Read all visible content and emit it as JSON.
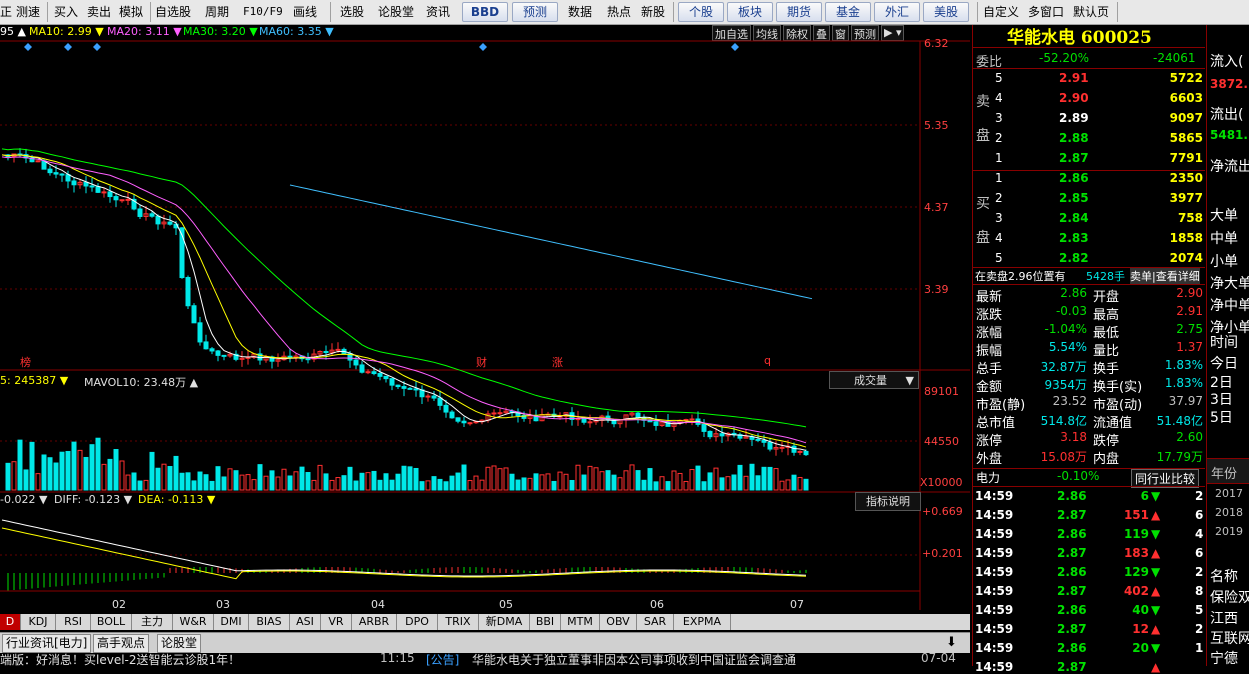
{
  "toolbar": {
    "left_items": [
      "正",
      "测速",
      "买入",
      "卖出",
      "模拟",
      "自选股",
      "周期",
      "F10/F9",
      "画线",
      "选股",
      "论股堂",
      "资讯"
    ],
    "bbd": "BBD",
    "forecast": "预测",
    "mid_items": [
      "数据",
      "热点",
      "新股"
    ],
    "market_buttons": [
      "个股",
      "板块",
      "期货",
      "基金",
      "外汇",
      "美股"
    ],
    "right_items": [
      "自定义",
      "多窗口",
      "默认页"
    ]
  },
  "chart": {
    "ma_labels": [
      {
        "text": "95 ▲",
        "color": "#ffffff"
      },
      {
        "text": "MA10: 2.99 ▼",
        "color": "#ffff00"
      },
      {
        "text": "MA20: 3.11 ▼",
        "color": "#ff60ff"
      },
      {
        "text": "MA30: 3.20 ▼",
        "color": "#00ff00"
      },
      {
        "text": "MA60: 3.35 ▼",
        "color": "#40c0ff"
      }
    ],
    "controls": [
      "加自选",
      "均线",
      "除权",
      "叠",
      "窗",
      "预测"
    ],
    "price_ticks": [
      "6.32",
      "5.35",
      "4.37",
      "3.39"
    ],
    "markers": [
      "榜",
      "财",
      "涨",
      "q"
    ],
    "vol_label_a": "5: 245387 ▼",
    "vol_label_b": "MAVOL10: 23.48万 ▲",
    "vol_dropdown": "成交量",
    "vol_ticks": [
      "89101",
      "44550",
      "X10000"
    ],
    "macd_label_a": "-0.022 ▼",
    "macd_label_b": "DIFF: -0.123 ▼",
    "macd_label_c": "DEA: -0.113 ▼",
    "macd_button": "指标说明",
    "macd_ticks": [
      "+0.669",
      "+0.201"
    ],
    "months": [
      "02",
      "03",
      "04",
      "05",
      "06",
      "07"
    ]
  },
  "index_tabs": [
    "D",
    "KDJ",
    "RSI",
    "BOLL",
    "主力",
    "W&R",
    "DMI",
    "BIAS",
    "ASI",
    "VR",
    "ARBR",
    "DPO",
    "TRIX",
    "新DMA",
    "BBI",
    "MTM",
    "OBV",
    "SAR",
    "EXPMA"
  ],
  "info_tabs": [
    "行业资讯[电力]",
    "高手观点",
    "论股堂"
  ],
  "news": {
    "left": "端版：好消息！买level-2送智能云诊股1年！",
    "time": "11:15",
    "tag": "[公告]",
    "headline": "华能水电关于独立董事非因本公司事项收到中国证监会调查通",
    "date": "07-04"
  },
  "quote": {
    "title": "华能水电 600025",
    "weibi_label": "委比",
    "weibi_pct": "-52.20%",
    "weibi_diff": "-24061",
    "sell_label": [
      "卖",
      "盘"
    ],
    "buy_label": [
      "买",
      "盘"
    ],
    "sells": [
      {
        "lvl": "5",
        "price": "2.91",
        "vol": "5722",
        "c": "#ff3030"
      },
      {
        "lvl": "4",
        "price": "2.90",
        "vol": "6603",
        "c": "#ff3030"
      },
      {
        "lvl": "3",
        "price": "2.89",
        "vol": "9097",
        "c": "#ffffff"
      },
      {
        "lvl": "2",
        "price": "2.88",
        "vol": "5865",
        "c": "#00e000"
      },
      {
        "lvl": "1",
        "price": "2.87",
        "vol": "7791",
        "c": "#00e000"
      }
    ],
    "buys": [
      {
        "lvl": "1",
        "price": "2.86",
        "vol": "2350",
        "c": "#00e000"
      },
      {
        "lvl": "2",
        "price": "2.85",
        "vol": "3977",
        "c": "#00e000"
      },
      {
        "lvl": "3",
        "price": "2.84",
        "vol": "758",
        "c": "#00e000"
      },
      {
        "lvl": "4",
        "price": "2.83",
        "vol": "1858",
        "c": "#00e000"
      },
      {
        "lvl": "5",
        "price": "2.82",
        "vol": "2074",
        "c": "#00e000"
      }
    ],
    "queue_a": "在卖盘2.96位置有",
    "queue_b": "5428手",
    "queue_c": "卖单|查看详细",
    "stats": [
      {
        "l": "最新",
        "v": "2.86",
        "vc": "#00e000",
        "l2": "开盘",
        "v2": "2.90",
        "v2c": "#ff3030"
      },
      {
        "l": "涨跌",
        "v": "-0.03",
        "vc": "#00e000",
        "l2": "最高",
        "v2": "2.91",
        "v2c": "#ff3030"
      },
      {
        "l": "涨幅",
        "v": "-1.04%",
        "vc": "#00e000",
        "l2": "最低",
        "v2": "2.75",
        "v2c": "#00e000"
      },
      {
        "l": "振幅",
        "v": "5.54%",
        "vc": "#00e8e8",
        "l2": "量比",
        "v2": "1.37",
        "v2c": "#ff3030"
      },
      {
        "l": "总手",
        "v": "32.87万",
        "vc": "#00e8e8",
        "l2": "换手",
        "v2": "1.83%",
        "v2c": "#00e8e8"
      },
      {
        "l": "金额",
        "v": "9354万",
        "vc": "#00e8e8",
        "l2": "换手(实)",
        "v2": "1.83%",
        "v2c": "#00e8e8"
      },
      {
        "l": "市盈(静)",
        "v": "23.52",
        "vc": "#c0c0c0",
        "l2": "市盈(动)",
        "v2": "37.97",
        "v2c": "#c0c0c0"
      },
      {
        "l": "总市值",
        "v": "514.8亿",
        "vc": "#00e8e8",
        "l2": "流通值",
        "v2": "51.48亿",
        "v2c": "#00e8e8"
      },
      {
        "l": "涨停",
        "v": "3.18",
        "vc": "#ff3030",
        "l2": "跌停",
        "v2": "2.60",
        "v2c": "#00e000"
      },
      {
        "l": "外盘",
        "v": "15.08万",
        "vc": "#ff3030",
        "l2": "内盘",
        "v2": "17.79万",
        "v2c": "#00e000"
      }
    ],
    "sector": "电力",
    "sector_pct": "-0.10%",
    "compare_btn": "同行业比较",
    "ticks": [
      {
        "t": "14:59",
        "p": "2.86",
        "pc": "#00e000",
        "v": "6",
        "d": "down",
        "x": "2"
      },
      {
        "t": "14:59",
        "p": "2.87",
        "pc": "#00e000",
        "v": "151",
        "d": "up",
        "x": "6"
      },
      {
        "t": "14:59",
        "p": "2.86",
        "pc": "#00e000",
        "v": "119",
        "d": "down",
        "x": "4"
      },
      {
        "t": "14:59",
        "p": "2.87",
        "pc": "#00e000",
        "v": "183",
        "d": "up",
        "x": "6"
      },
      {
        "t": "14:59",
        "p": "2.86",
        "pc": "#00e000",
        "v": "129",
        "d": "down",
        "x": "2"
      },
      {
        "t": "14:59",
        "p": "2.87",
        "pc": "#00e000",
        "v": "402",
        "d": "up",
        "x": "8"
      },
      {
        "t": "14:59",
        "p": "2.86",
        "pc": "#00e000",
        "v": "40",
        "d": "down",
        "x": "5"
      },
      {
        "t": "14:59",
        "p": "2.87",
        "pc": "#00e000",
        "v": "12",
        "d": "up",
        "x": "2"
      },
      {
        "t": "14:59",
        "p": "2.86",
        "pc": "#00e000",
        "v": "20",
        "d": "down",
        "x": "1"
      },
      {
        "t": "14:59",
        "p": "2.87",
        "pc": "#00e000",
        "v": "",
        "d": "up",
        "x": ""
      }
    ]
  },
  "far_right": {
    "items": [
      {
        "t": "流入(",
        "c": "#ffffff"
      },
      {
        "t": "3872.",
        "c": "#ff3030"
      },
      {
        "t": "流出(",
        "c": "#ffffff"
      },
      {
        "t": "5481.",
        "c": "#00e000"
      },
      {
        "t": "净流出",
        "c": "#ffffff"
      },
      {
        "t": "大单",
        "c": "#ffffff"
      },
      {
        "t": "中单",
        "c": "#ffffff"
      },
      {
        "t": "小单",
        "c": "#ffffff"
      },
      {
        "t": "净大单",
        "c": "#ffffff"
      },
      {
        "t": "净中单",
        "c": "#ffffff"
      },
      {
        "t": "净小单",
        "c": "#ffffff"
      },
      {
        "t": "时间",
        "c": "#ffffff"
      },
      {
        "t": "今日",
        "c": "#ffffff"
      },
      {
        "t": "2日",
        "c": "#ffffff"
      },
      {
        "t": "3日",
        "c": "#ffffff"
      },
      {
        "t": "5日",
        "c": "#ffffff"
      }
    ],
    "year_label": "年份",
    "years": [
      "2017",
      "2018",
      "2019"
    ],
    "name_label": "名称",
    "names": [
      "保险双",
      "江西",
      "互联网",
      "宁德"
    ]
  }
}
